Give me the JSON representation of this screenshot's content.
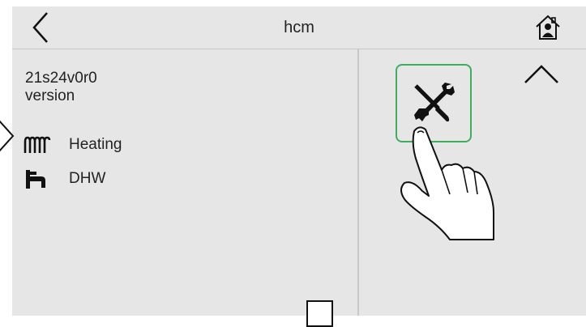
{
  "header": {
    "title": "hcm",
    "back_icon": "chevron-left-icon",
    "home_icon": "home-icon"
  },
  "info": {
    "version_value": "21s24v0r0",
    "version_label": "version"
  },
  "menu": {
    "items": [
      {
        "label": "Heating",
        "icon": "radiator-icon",
        "selected": true
      },
      {
        "label": "DHW",
        "icon": "faucet-icon",
        "selected": false
      }
    ]
  },
  "right_panel": {
    "tools_icon": "tools-icon",
    "tools_border_color": "#3fae5c",
    "scroll_icon": "chevron-up-icon",
    "pointer_overlay": "pointing-hand-icon"
  },
  "colors": {
    "background": "#e6e6e6",
    "divider": "#c8c8c8",
    "accent": "#3fae5c"
  }
}
